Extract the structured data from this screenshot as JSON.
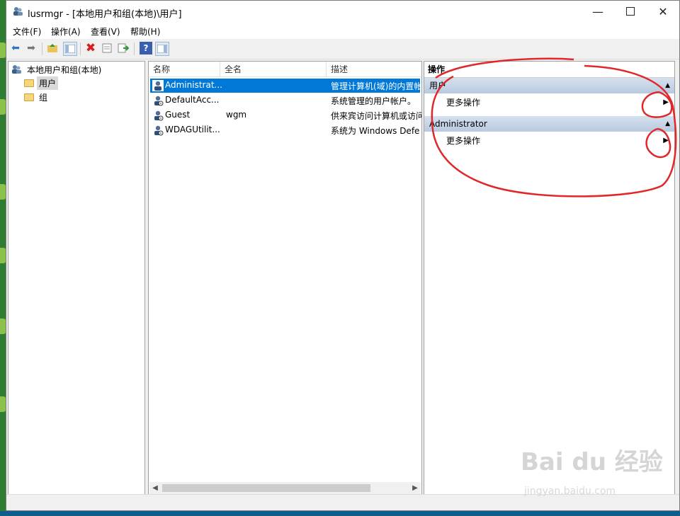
{
  "window": {
    "title": "lusrmgr - [本地用户和组(本地)\\用户]",
    "controls": [
      "minimize-icon",
      "maximize-icon",
      "close-icon"
    ]
  },
  "menu": [
    "文件(F)",
    "操作(A)",
    "查看(V)",
    "帮助(H)"
  ],
  "toolbar": [
    "back-icon",
    "forward-icon",
    "up-folder-icon",
    "show-hide-tree-icon",
    "delete-icon",
    "properties-icon",
    "export-list-icon",
    "help-icon",
    "show-hide-action-pane-icon"
  ],
  "tree": {
    "root": "本地用户和组(本地)",
    "children": [
      "用户",
      "组"
    ],
    "selected": "用户"
  },
  "list": {
    "columns": [
      "名称",
      "全名",
      "描述"
    ],
    "rows": [
      {
        "name": "Administrat...",
        "fullname": "",
        "desc": "管理计算机(域)的内置帐",
        "selected": true
      },
      {
        "name": "DefaultAcc...",
        "fullname": "",
        "desc": "系统管理的用户帐户。",
        "selected": false
      },
      {
        "name": "Guest",
        "fullname": "wgm",
        "desc": "供来宾访问计算机或访问",
        "selected": false
      },
      {
        "name": "WDAGUtilit...",
        "fullname": "",
        "desc": "系统为 Windows Defe",
        "selected": false
      }
    ]
  },
  "actions": {
    "header": "操作",
    "groups": [
      {
        "title": "用户",
        "items": [
          "更多操作"
        ]
      },
      {
        "title": "Administrator",
        "items": [
          "更多操作"
        ]
      }
    ]
  },
  "watermark": {
    "main": "Bai du 经验",
    "sub": "jingyan.baidu.com"
  },
  "colors": {
    "selection": "#0078d7",
    "annotation": "#e0282a",
    "group_header": "#c7d5e8"
  }
}
